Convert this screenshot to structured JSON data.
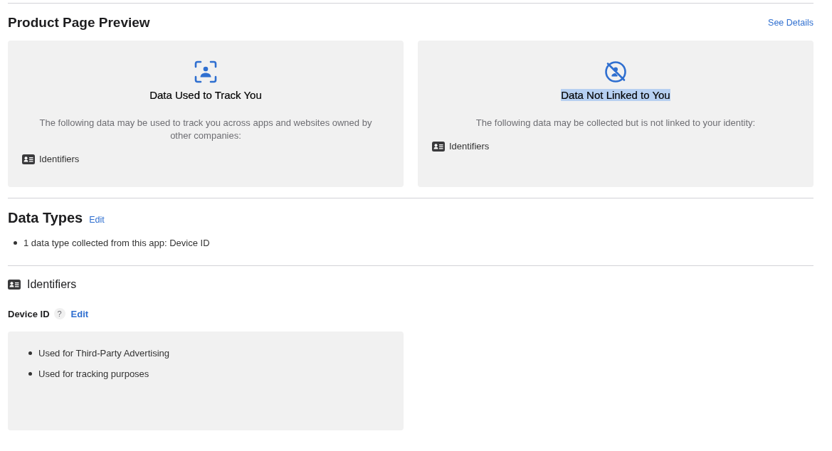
{
  "preview": {
    "title": "Product Page Preview",
    "link": "See Details",
    "cards": [
      {
        "kind": "track",
        "title": "Data Used to Track You",
        "title_highlighted": false,
        "description": "The following data may be used to track you across apps and websites owned by other companies:",
        "items": [
          "Identifiers"
        ]
      },
      {
        "kind": "not_linked",
        "title": "Data Not Linked to You",
        "title_highlighted": true,
        "description": "The following data may be collected but is not linked to your identity:",
        "items": [
          "Identifiers"
        ]
      }
    ]
  },
  "data_types": {
    "title": "Data Types",
    "edit": "Edit",
    "bullets": [
      "1 data type collected from this app: Device ID"
    ]
  },
  "category": {
    "title": "Identifiers",
    "field": {
      "label": "Device ID",
      "help": "?",
      "edit": "Edit",
      "purposes": [
        "Used for Third-Party Advertising",
        "Used for tracking purposes"
      ]
    }
  }
}
